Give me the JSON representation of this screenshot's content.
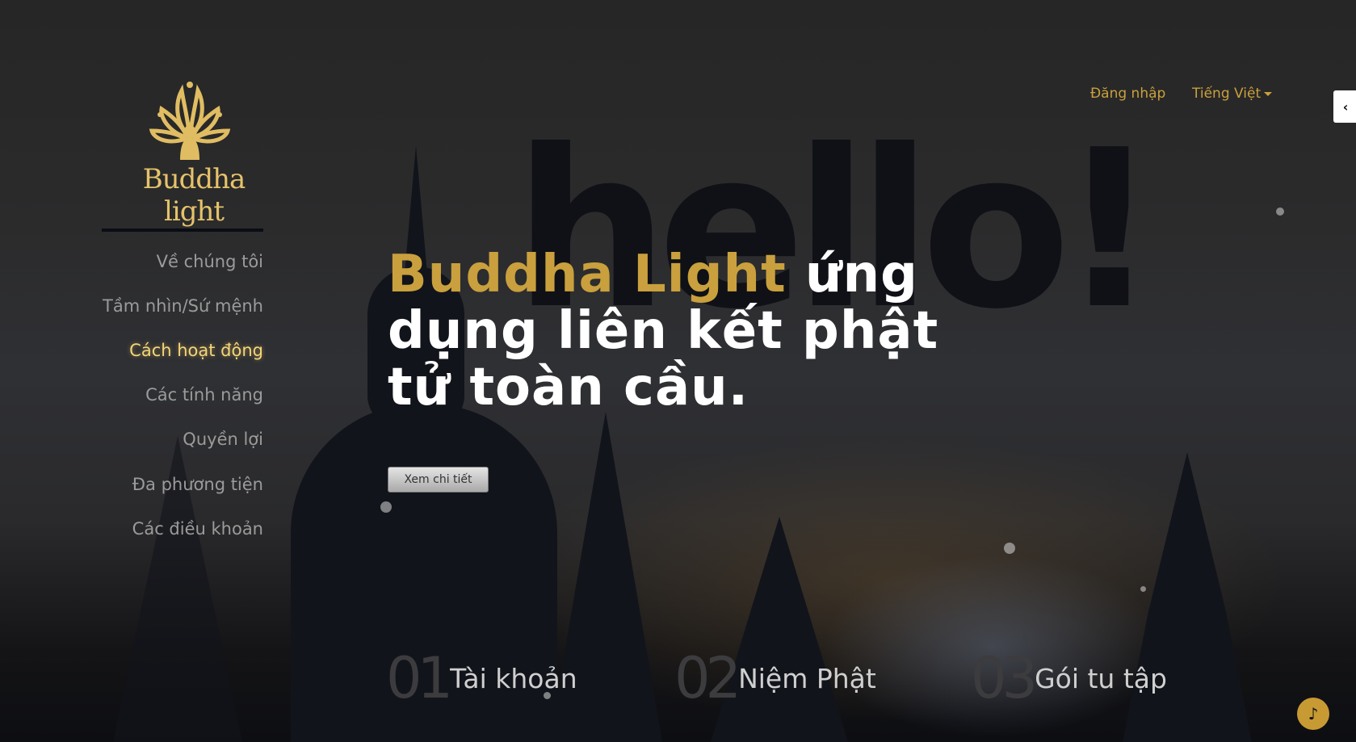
{
  "brand": {
    "logo_text": "Buddha light"
  },
  "nav": {
    "items": [
      {
        "label": "Về chúng tôi",
        "active": false
      },
      {
        "label": "Tầm nhìn/Sứ mệnh",
        "active": false
      },
      {
        "label": "Cách hoạt động",
        "active": true
      },
      {
        "label": "Các tính năng",
        "active": false
      },
      {
        "label": "Quyền lợi",
        "active": false
      },
      {
        "label": "Đa phương tiện",
        "active": false
      },
      {
        "label": "Các điều khoản",
        "active": false
      }
    ]
  },
  "header": {
    "login": "Đăng nhập",
    "language": "Tiếng Việt"
  },
  "hero": {
    "bg_word": "hello!",
    "brand": "Buddha Light",
    "rest": " ứng dụng liên kết phật tử toàn cầu.",
    "button": "Xem chi tiết"
  },
  "features": [
    {
      "num": "01",
      "label": "Tài khoản"
    },
    {
      "num": "02",
      "label": "Niệm Phật"
    },
    {
      "num": "03",
      "label": "Gói tu tập"
    }
  ],
  "colors": {
    "accent": "#c9a03d"
  }
}
